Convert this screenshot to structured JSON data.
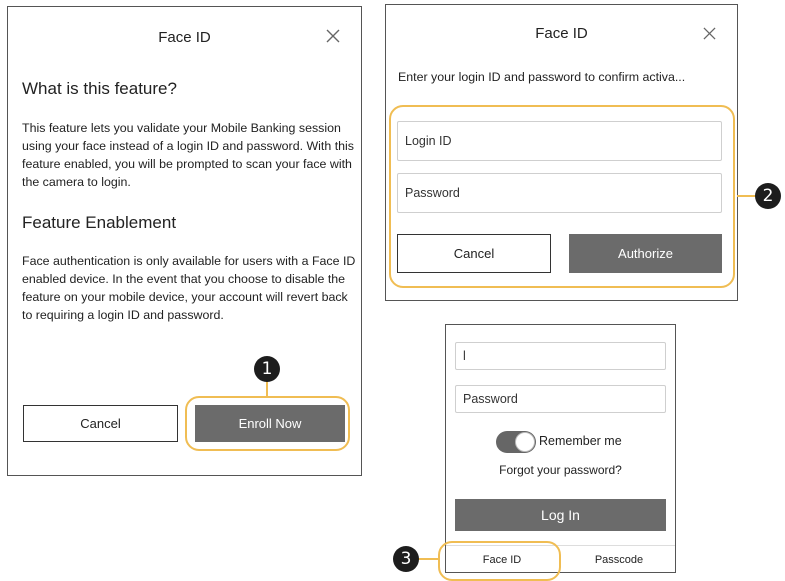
{
  "colors": {
    "highlight": "#f0bd53",
    "primary_button": "#6b6b6b",
    "step_badge": "#1d1d1d"
  },
  "enroll_dialog": {
    "title": "Face ID",
    "close_icon": "close-icon",
    "section1_heading": "What is this feature?",
    "section1_text": "This feature lets you validate your Mobile Banking session using your face instead of a login ID and password. With this feature enabled, you will be prompted to scan your face with the camera to login.",
    "section2_heading": "Feature Enablement",
    "section2_text": "Face authentication is only available for users with a Face ID enabled device. In the event that you choose to disable the feature on your mobile device, your account will revert back to requiring a login ID and password.",
    "cancel_label": "Cancel",
    "enroll_label": "Enroll Now",
    "step": "1"
  },
  "authorize_dialog": {
    "title": "Face ID",
    "close_icon": "close-icon",
    "instruction": "Enter your login ID and password to confirm activa...",
    "login_placeholder": "Login ID",
    "password_placeholder": "Password",
    "cancel_label": "Cancel",
    "authorize_label": "Authorize",
    "step": "2"
  },
  "login_screen": {
    "login_value": "l",
    "password_placeholder": "Password",
    "remember_label": "Remember me",
    "remember_on": true,
    "forgot_label": "Forgot your password?",
    "login_button": "Log In",
    "tabs": [
      "Face ID",
      "Passcode"
    ],
    "step": "3"
  }
}
